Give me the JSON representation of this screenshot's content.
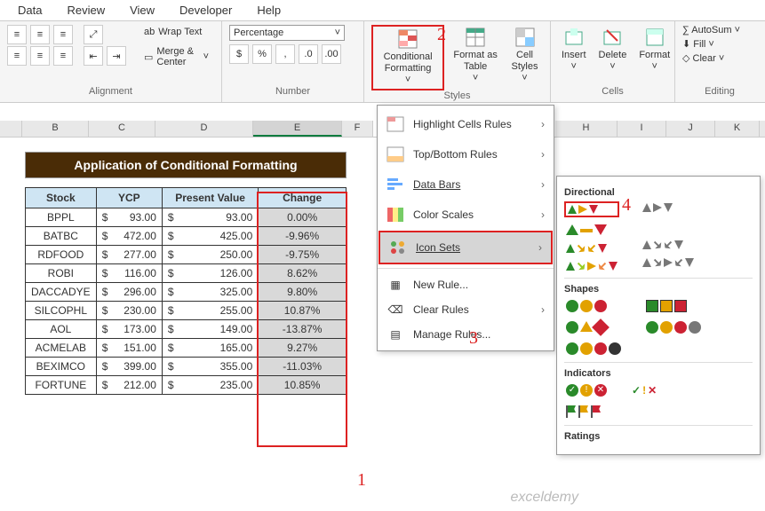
{
  "tabs": {
    "data": "Data",
    "review": "Review",
    "view": "View",
    "developer": "Developer",
    "help": "Help"
  },
  "ribbon": {
    "alignment": {
      "wrap": "Wrap Text",
      "merge": "Merge & Center",
      "label": "Alignment"
    },
    "number": {
      "format": "Percentage",
      "label": "Number"
    },
    "styles": {
      "cond": "Conditional Formatting",
      "fmtas": "Format as Table",
      "cellst": "Cell Styles",
      "label": "Styles"
    },
    "cells": {
      "insert": "Insert",
      "delete": "Delete",
      "format": "Format",
      "label": "Cells"
    },
    "editing": {
      "autosum": "AutoSum",
      "fill": "Fill",
      "clear": "Clear",
      "label": "Editing"
    }
  },
  "cols": [
    "B",
    "C",
    "D",
    "E",
    "F",
    "H",
    "I",
    "J",
    "K"
  ],
  "title": "Application of Conditional Formatting",
  "headers": {
    "stock": "Stock",
    "ycp": "YCP",
    "pv": "Present Value",
    "change": "Change"
  },
  "rows": [
    {
      "stock": "BPPL",
      "ycp": "93.00",
      "pv": "93.00",
      "chg": "0.00%"
    },
    {
      "stock": "BATBC",
      "ycp": "472.00",
      "pv": "425.00",
      "chg": "-9.96%"
    },
    {
      "stock": "RDFOOD",
      "ycp": "277.00",
      "pv": "250.00",
      "chg": "-9.75%"
    },
    {
      "stock": "ROBI",
      "ycp": "116.00",
      "pv": "126.00",
      "chg": "8.62%"
    },
    {
      "stock": "DACCADYE",
      "ycp": "296.00",
      "pv": "325.00",
      "chg": "9.80%"
    },
    {
      "stock": "SILCOPHL",
      "ycp": "230.00",
      "pv": "255.00",
      "chg": "10.87%"
    },
    {
      "stock": "AOL",
      "ycp": "173.00",
      "pv": "149.00",
      "chg": "-13.87%"
    },
    {
      "stock": "ACMELAB",
      "ycp": "151.00",
      "pv": "165.00",
      "chg": "9.27%"
    },
    {
      "stock": "BEXIMCO",
      "ycp": "399.00",
      "pv": "355.00",
      "chg": "-11.03%"
    },
    {
      "stock": "FORTUNE",
      "ycp": "212.00",
      "pv": "235.00",
      "chg": "10.85%"
    }
  ],
  "cfmenu": {
    "hlr": "Highlight Cells Rules",
    "tbr": "Top/Bottom Rules",
    "db": "Data Bars",
    "cs": "Color Scales",
    "is": "Icon Sets",
    "new": "New Rule...",
    "clr": "Clear Rules",
    "mgr": "Manage Rules..."
  },
  "iconsets": {
    "directional": "Directional",
    "shapes": "Shapes",
    "indicators": "Indicators",
    "ratings": "Ratings"
  },
  "callouts": {
    "c1": "1",
    "c2": "2",
    "c3": "3",
    "c4": "4"
  },
  "watermark": "exceldemy"
}
